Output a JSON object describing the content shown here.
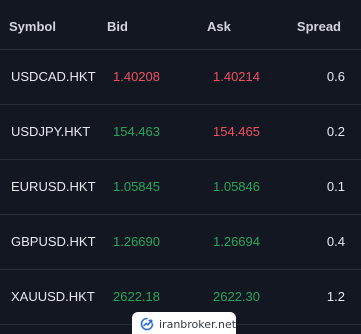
{
  "table": {
    "headers": {
      "symbol": "Symbol",
      "bid": "Bid",
      "ask": "Ask",
      "spread": "Spread"
    },
    "rows": [
      {
        "symbol": "USDCAD.HKT",
        "bid": "1.40208",
        "ask": "1.40214",
        "spread": "0.6",
        "bid_dir": "down",
        "ask_dir": "down"
      },
      {
        "symbol": "USDJPY.HKT",
        "bid": "154.463",
        "ask": "154.465",
        "spread": "0.2",
        "bid_dir": "up",
        "ask_dir": "down"
      },
      {
        "symbol": "EURUSD.HKT",
        "bid": "1.05845",
        "ask": "1.05846",
        "spread": "0.1",
        "bid_dir": "up",
        "ask_dir": "up"
      },
      {
        "symbol": "GBPUSD.HKT",
        "bid": "1.26690",
        "ask": "1.26694",
        "spread": "0.4",
        "bid_dir": "up",
        "ask_dir": "up"
      },
      {
        "symbol": "XAUUSD.HKT",
        "bid": "2622.18",
        "ask": "2622.30",
        "spread": "1.2",
        "bid_dir": "up",
        "ask_dir": "up"
      }
    ]
  },
  "watermark": {
    "text": "iranbroker.net",
    "icon": "iranbroker-logo-icon"
  },
  "colors": {
    "background": "#131722",
    "divider": "#2a2e39",
    "header_text": "#d1d4dc",
    "up": "#26a65b",
    "down": "#ef5061"
  }
}
